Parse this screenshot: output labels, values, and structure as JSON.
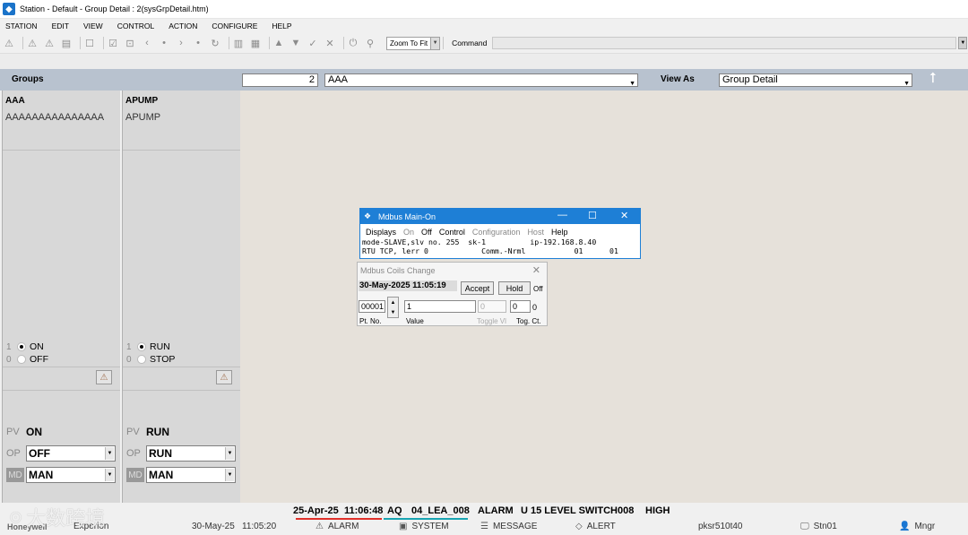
{
  "window": {
    "title": "Station - Default - Group Detail : 2(sysGrpDetail.htm)"
  },
  "menu": [
    "STATION",
    "EDIT",
    "VIEW",
    "CONTROL",
    "ACTION",
    "CONFIGURE",
    "HELP"
  ],
  "toolbar": {
    "zoom_label": "Zoom To Fit",
    "command_label": "Command",
    "command_value": ""
  },
  "header": {
    "groups_label": "Groups",
    "group_number": "2",
    "group_name": "AAA",
    "view_as_label": "View As",
    "view_as_value": "Group Detail"
  },
  "points": [
    {
      "name": "AAA",
      "description": "AAAAAAAAAAAAAAA",
      "state1_num": "1",
      "state1_label": "ON",
      "state0_num": "0",
      "state0_label": "OFF",
      "pv_label": "PV",
      "pv_value": "ON",
      "op_label": "OP",
      "op_value": "OFF",
      "md_label": "MD",
      "md_value": "MAN"
    },
    {
      "name": "APUMP",
      "description": "APUMP",
      "state1_num": "1",
      "state1_label": "RUN",
      "state0_num": "0",
      "state0_label": "STOP",
      "pv_label": "PV",
      "pv_value": "RUN",
      "op_label": "OP",
      "op_value": "RUN",
      "md_label": "MD",
      "md_value": "MAN"
    }
  ],
  "modbus": {
    "title": "Mdbus Main-On",
    "menu": [
      "Displays",
      "On",
      "Off",
      "Control",
      "Configuration",
      "Host",
      "Help"
    ],
    "line1": "mode-SLAVE,slv no. 255  sk-1          ip-192.168.8.40",
    "line2": "RTU TCP, lerr 0            Comm.-Nrml           01      01"
  },
  "coils": {
    "title": "Mdbus Coils Change",
    "datetime": "30-May-2025 11:05:19",
    "accept_label": "Accept",
    "hold_label": "Hold",
    "off_label": "Off",
    "pt_no_value": "00001",
    "value_value": "1",
    "toggle_value": "0",
    "tog_ct_value": "0",
    "tog_ct_display": "0",
    "pt_no_label": "Pt. No.",
    "value_label": "Value",
    "toggle_label": "Toggle Vl",
    "tog_ct_label": "Tog. Ct."
  },
  "alarm": {
    "date": "25-Apr-25",
    "time": "11:06:48",
    "type": "AQ",
    "point": "04_LEA_008",
    "status": "ALARM",
    "description": "U 15 LEVEL SWITCH008",
    "priority": "HIGH"
  },
  "status": {
    "brand": "Honeywell",
    "experion": "Experion",
    "date": "30-May-25",
    "time": "11:05:20",
    "alarm_label": "ALARM",
    "system_label": "SYSTEM",
    "message_label": "MESSAGE",
    "alert_label": "ALERT",
    "server": "pksr510t40",
    "station": "Stn01",
    "user": "Mngr"
  },
  "watermark": "大数跨境"
}
